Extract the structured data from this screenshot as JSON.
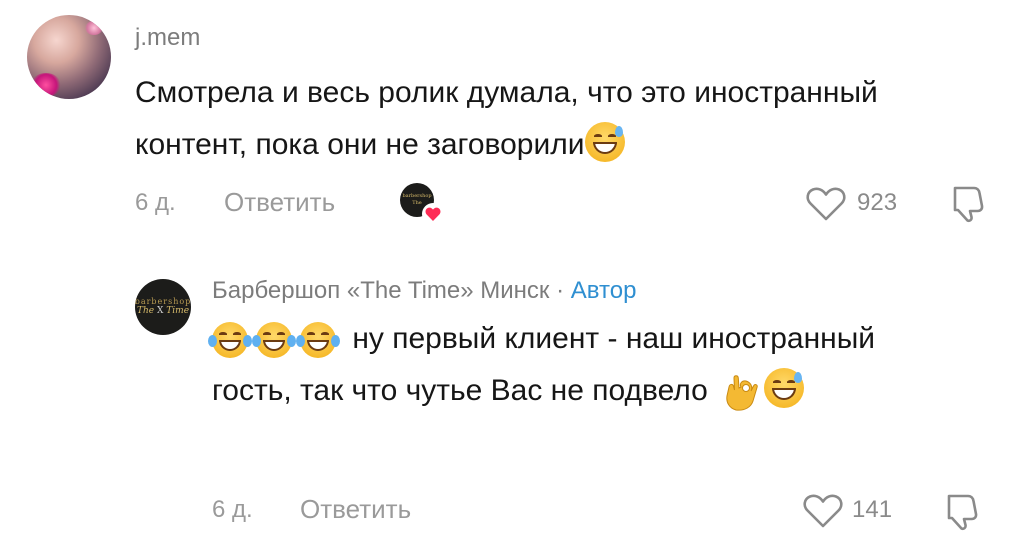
{
  "comments": [
    {
      "username": "j.mem",
      "text": "Смотрела и весь ролик думала, что это иностранный контент, пока они не заговорили",
      "time": "6 д.",
      "reply_label": "Ответить",
      "likes": "923",
      "emoji_end": "sweat-smile"
    },
    {
      "username": "Барбершоп «The Time» Минск",
      "separator": "·",
      "author_tag": "Автор",
      "avatar_text_top": "barbershop",
      "avatar_text_main": "The",
      "avatar_text_x": "X",
      "avatar_text_end": "Time",
      "text_part1": "ну первый клиент - наш иностранный гость, так что чутье Вас не подвело",
      "time": "6 д.",
      "reply_label": "Ответить",
      "likes": "141"
    }
  ],
  "colors": {
    "meta_gray": "#9a9a9a",
    "author_blue": "#2f8fd1",
    "like_heart_red": "#fe2c55"
  },
  "icons": [
    "heart-outline-icon",
    "dislike-icon",
    "laughing-tears-emoji",
    "sweat-smile-emoji",
    "ok-hand-emoji",
    "heart-filled-icon"
  ]
}
